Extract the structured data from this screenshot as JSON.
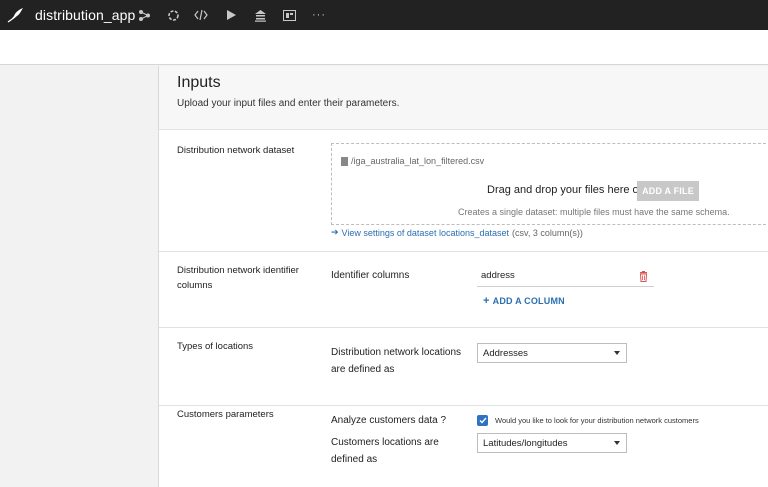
{
  "app": {
    "name": "distribution_app",
    "toolbar_icons": [
      "flow-icon",
      "recipe-icon",
      "code-icon",
      "run-icon",
      "library-icon",
      "dashboard-icon",
      "more-icon"
    ]
  },
  "inputs": {
    "title": "Inputs",
    "subtitle": "Upload your input files and enter their parameters."
  },
  "dataset_section": {
    "label": "Distribution network dataset",
    "file_name": "/iga_australia_lat_lon_filtered.csv",
    "drag_text": "Drag and drop your files here or",
    "add_file_label": "ADD A FILE",
    "schema_note": "Creates a single dataset: multiple files must have the same schema.",
    "view_link": "View settings of dataset locations_dataset",
    "view_meta": "(csv, 3 column(s))"
  },
  "identifier_section": {
    "label": "Distribution network identifier columns",
    "field_label": "Identifier columns",
    "value": "address",
    "add_column_label": "ADD A COLUMN"
  },
  "types_section": {
    "label": "Types of locations",
    "field_label": "Distribution network locations are defined as",
    "selected": "Addresses"
  },
  "customers_section": {
    "label": "Customers parameters",
    "analyze_label": "Analyze customers data ?",
    "checkbox_checked": true,
    "checkbox_text": "Would you like to look for your distribution network customers",
    "locations_label": "Customers locations are defined as",
    "selected": "Latitudes/longitudes"
  },
  "colors": {
    "accent": "#2f72c4",
    "topbar": "#222222",
    "link": "#2a6fb0",
    "delete": "#d9534f"
  }
}
